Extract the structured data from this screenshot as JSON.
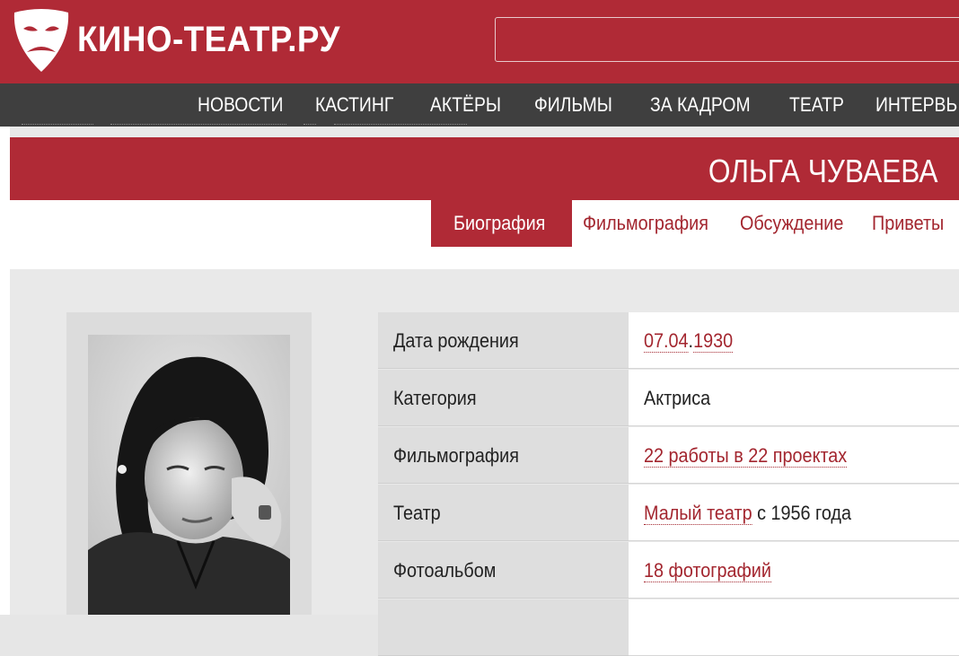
{
  "header": {
    "logo_text": "КИНО-ТЕАТР.РУ",
    "search_value": "",
    "search_placeholder": ""
  },
  "nav": {
    "items": [
      {
        "label": "НОВОСТИ"
      },
      {
        "label": "КАСТИНГ"
      },
      {
        "label": "АКТЁРЫ"
      },
      {
        "label": "ФИЛЬМЫ"
      },
      {
        "label": "ЗА КАДРОМ"
      },
      {
        "label": "ТЕАТР"
      },
      {
        "label": "ИНТЕРВЬ"
      }
    ]
  },
  "person": {
    "name": "ОЛЬГА ЧУВАЕВА"
  },
  "tabs": [
    {
      "label": "Биография",
      "active": true
    },
    {
      "label": "Фильмография",
      "active": false
    },
    {
      "label": "Обсуждение",
      "active": false
    },
    {
      "label": "Приветы",
      "active": false
    }
  ],
  "info": {
    "birth": {
      "label": "Дата рождения",
      "day": "07.04",
      "sep": ".",
      "year": "1930"
    },
    "category": {
      "label": "Категория",
      "value": "Актриса"
    },
    "filmography": {
      "label": "Фильмография",
      "value": "22 работы в 22 проектах"
    },
    "theatre": {
      "label": "Театр",
      "link": "Малый театр",
      "suffix": " с 1956 года"
    },
    "album": {
      "label": "Фотоальбом",
      "value": "18 фотографий"
    }
  },
  "colors": {
    "brand_red": "#b02a36",
    "nav_gray": "#3f3f3f",
    "link_red": "#a3262f"
  }
}
